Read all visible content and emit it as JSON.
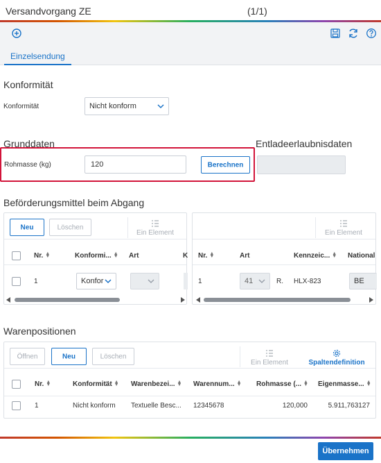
{
  "window": {
    "title": "Versandvorgang ZE",
    "counter": "(1/1)"
  },
  "toolbar": {
    "tab_label": "Einzelsendung",
    "icons": [
      "add-circle-icon",
      "save-icon",
      "refresh-icon",
      "help-icon"
    ]
  },
  "konformitaet": {
    "section_title": "Konformität",
    "field_label": "Konformität",
    "value": "Nicht konform"
  },
  "grunddaten": {
    "section_title": "Grunddaten",
    "rohmasse_label": "Rohmasse (kg)",
    "rohmasse_value": "120",
    "berechnen_label": "Berechnen"
  },
  "entladeerlaubnis": {
    "section_title": "Entladeerlaubnisdaten",
    "value": ""
  },
  "befoerderung": {
    "section_title": "Beförderungsmittel beim Abgang",
    "left": {
      "new_label": "Neu",
      "delete_label": "Löschen",
      "element_label": "Ein Element",
      "columns": [
        "Nr.",
        "Konformi...",
        "Art",
        "K"
      ],
      "row": {
        "nr": "1",
        "konformitaet": "Konfor",
        "art": ""
      }
    },
    "right": {
      "element_label": "Ein Element",
      "columns": [
        "Nr.",
        "Art",
        "Kennzeic...",
        "National"
      ],
      "row": {
        "nr": "1",
        "art": "41",
        "extra": "R.",
        "kennzeichen": "HLX-823",
        "national": "BE"
      }
    }
  },
  "waren": {
    "section_title": "Warenpositionen",
    "open_label": "Öffnen",
    "new_label": "Neu",
    "delete_label": "Löschen",
    "element_label": "Ein Element",
    "spalten_label": "Spaltendefinition",
    "columns": [
      "Nr.",
      "Konformität",
      "Warenbezei...",
      "Warennum...",
      "Rohmasse (...",
      "Eigenmasse..."
    ],
    "rows": [
      {
        "nr": "1",
        "konformitaet": "Nicht konform",
        "warenbez": "Textuelle Besc...",
        "warennum": "12345678",
        "rohmasse": "120,000",
        "eigenmasse": "5.911,763127"
      }
    ]
  },
  "footer": {
    "submit_label": "Übernehmen"
  },
  "colors": {
    "accent": "#1a73c8",
    "highlight": "#d2143a"
  }
}
